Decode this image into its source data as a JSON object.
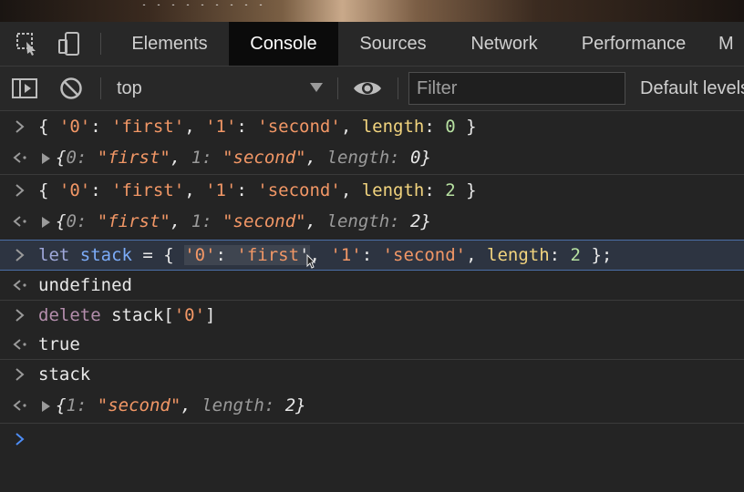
{
  "tabs": [
    "Elements",
    "Console",
    "Sources",
    "Network",
    "Performance",
    "M"
  ],
  "active_tab": "Console",
  "toolbar": {
    "context": "top",
    "filter_placeholder": "Filter",
    "levels": "Default levels"
  },
  "console": {
    "entries": [
      {
        "type": "input",
        "text": "{ '0': 'first', '1': 'second', length: 0 }"
      },
      {
        "type": "output",
        "text": "{0: \"first\", 1: \"second\", length: 0}"
      },
      {
        "type": "input",
        "text": "{ '0': 'first', '1': 'second', length: 2 }"
      },
      {
        "type": "output",
        "text": "{0: \"first\", 1: \"second\", length: 2}"
      },
      {
        "type": "input",
        "text": "let stack = { '0': 'first', '1': 'second', length: 2 };"
      },
      {
        "type": "output",
        "text": "undefined"
      },
      {
        "type": "input",
        "text": "delete stack['0']"
      },
      {
        "type": "output",
        "text": "true"
      },
      {
        "type": "input",
        "text": "stack"
      },
      {
        "type": "output",
        "text": "{1: \"second\", length: 2}"
      }
    ]
  },
  "colors": {
    "background": "#242424",
    "active_tab": "#0b0b0b",
    "string": "#f29766",
    "number": "#b7e1a1",
    "keyword": "#b48ead",
    "prompt_active": "#4d8df6"
  }
}
